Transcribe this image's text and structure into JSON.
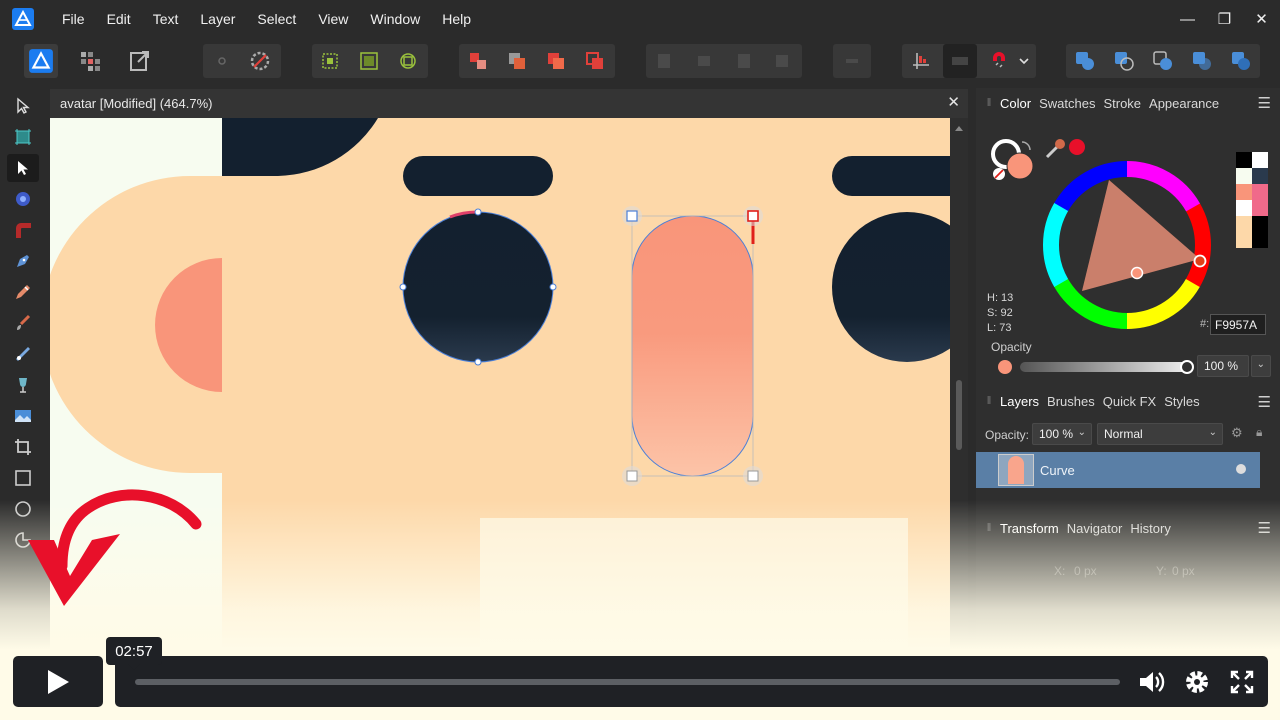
{
  "menu": [
    "File",
    "Edit",
    "Text",
    "Layer",
    "Select",
    "View",
    "Window",
    "Help"
  ],
  "window_controls": {
    "minimize": "—",
    "restore": "❐",
    "close": "✕"
  },
  "document": {
    "title": "avatar [Modified] (464.7%)",
    "close": "✕"
  },
  "color_panel": {
    "tabs": [
      "Color",
      "Swatches",
      "Stroke",
      "Appearance"
    ],
    "h": "H: 13",
    "s": "S: 92",
    "l": "L: 73",
    "hex_label": "#:",
    "hex": "F9957A",
    "opacity_label": "Opacity",
    "opacity_value": "100 %",
    "current_color": "#F9957A"
  },
  "layers_panel": {
    "tabs": [
      "Layers",
      "Brushes",
      "Quick FX",
      "Styles"
    ],
    "opacity_label": "Opacity:",
    "opacity_value": "100 %",
    "blend_mode": "Normal",
    "layer_name": "Curve"
  },
  "transform_panel": {
    "tabs": [
      "Transform",
      "Navigator",
      "History"
    ],
    "x_label": "X:",
    "x_value": "0 px",
    "y_label": "Y:",
    "y_value": "0 px"
  },
  "video": {
    "time": "02:57",
    "progress": 0.0
  },
  "colors": {
    "accent": "#2b6fd6",
    "canvas_skin": "#fdd8a9",
    "navy": "#13202f",
    "salmon": "#f9957a",
    "arrow_red": "#e8102a"
  }
}
